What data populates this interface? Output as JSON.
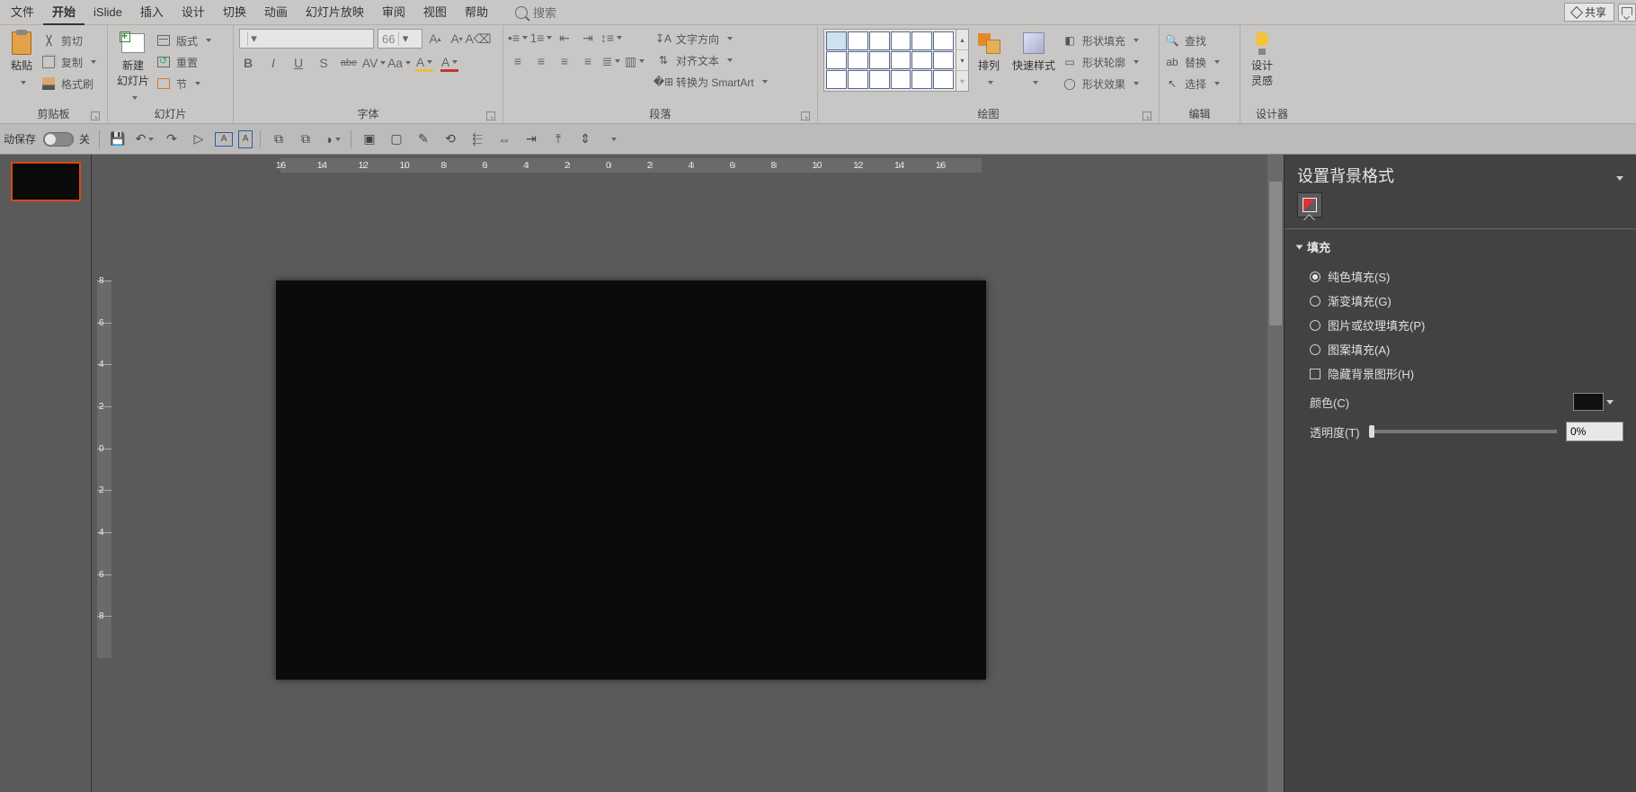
{
  "menu": {
    "tabs": [
      "文件",
      "开始",
      "iSlide",
      "插入",
      "设计",
      "切换",
      "动画",
      "幻灯片放映",
      "审阅",
      "视图",
      "帮助"
    ],
    "active_index": 1,
    "search_placeholder": "搜索",
    "share_label": "共享"
  },
  "ribbon": {
    "clipboard": {
      "label": "剪贴板",
      "paste": "粘贴",
      "cut": "剪切",
      "copy": "复制",
      "format_painter": "格式刷"
    },
    "slides": {
      "label": "幻灯片",
      "new_slide": "新建\n幻灯片",
      "layout": "版式",
      "reset": "重置",
      "section": "节"
    },
    "font": {
      "label": "字体",
      "font_name": "",
      "font_size": "66",
      "buttons": [
        "B",
        "I",
        "U",
        "S",
        "abe",
        "AV",
        "Aa",
        "A",
        "A"
      ]
    },
    "paragraph": {
      "label": "段落",
      "text_direction": "文字方向",
      "align_text": "对齐文本",
      "convert_smartart": "转换为 SmartArt"
    },
    "drawing": {
      "label": "绘图",
      "arrange": "排列",
      "quick_styles": "快速样式",
      "shape_fill": "形状填充",
      "shape_outline": "形状轮廓",
      "shape_effects": "形状效果"
    },
    "editing": {
      "label": "编辑",
      "find": "查找",
      "replace": "替换",
      "select": "选择"
    },
    "designer": {
      "label": "设计器",
      "btn": "设计\n灵感"
    }
  },
  "qa": {
    "autosave_label": "动保存",
    "autosave_state": "关"
  },
  "ruler": {
    "h": [
      "16",
      "14",
      "12",
      "10",
      "8",
      "6",
      "4",
      "2",
      "0",
      "2",
      "4",
      "6",
      "8",
      "10",
      "12",
      "14",
      "16"
    ],
    "v": [
      "8",
      "6",
      "4",
      "2",
      "0",
      "2",
      "4",
      "6",
      "8"
    ]
  },
  "panel": {
    "title": "设置背景格式",
    "section": "填充",
    "options": {
      "solid": "纯色填充(S)",
      "gradient": "渐变填充(G)",
      "picture": "图片或纹理填充(P)",
      "pattern": "图案填充(A)",
      "hide_bg": "隐藏背景图形(H)"
    },
    "color_label": "颜色(C)",
    "transparency_label": "透明度(T)",
    "transparency_value": "0%"
  }
}
